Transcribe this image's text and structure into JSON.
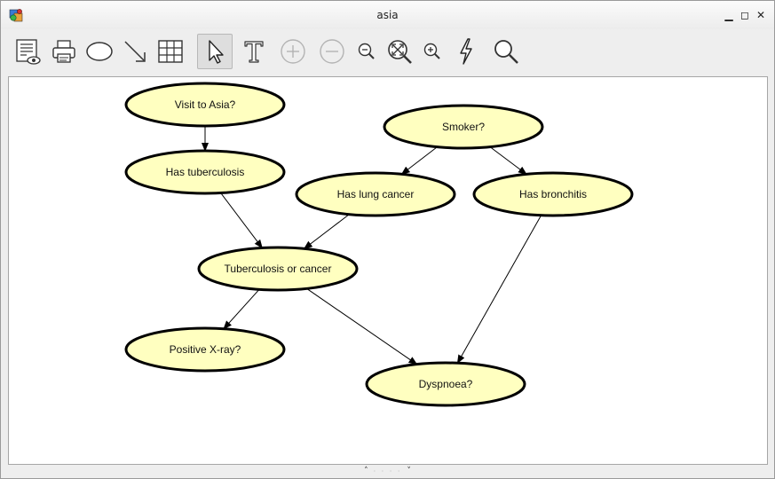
{
  "window": {
    "title": "asia",
    "controls": {
      "minimize": "▁",
      "maximize": "◻",
      "close": "✕"
    }
  },
  "toolbar": {
    "buttons": [
      {
        "name": "node-monitor-button",
        "icon": "monitor-eye-icon"
      },
      {
        "name": "print-button",
        "icon": "printer-icon"
      },
      {
        "name": "add-node-button",
        "icon": "ellipse-icon"
      },
      {
        "name": "add-arc-button",
        "icon": "arrow-icon"
      },
      {
        "name": "table-button",
        "icon": "table-icon"
      },
      {
        "name": "select-button",
        "icon": "pointer-icon",
        "active": true
      },
      {
        "name": "text-button",
        "icon": "text-icon"
      },
      {
        "name": "expand-button",
        "icon": "plus-circle-icon",
        "disabled": true
      },
      {
        "name": "collapse-button",
        "icon": "minus-circle-icon",
        "disabled": true
      },
      {
        "name": "zoom-out-button",
        "icon": "zoom-out-icon"
      },
      {
        "name": "zoom-fit-button",
        "icon": "zoom-fit-icon"
      },
      {
        "name": "zoom-in-button",
        "icon": "zoom-in-icon"
      },
      {
        "name": "propagate-button",
        "icon": "lightning-icon"
      },
      {
        "name": "search-button",
        "icon": "search-icon"
      }
    ]
  },
  "network": {
    "node_fill": "#ffffc0",
    "node_stroke": "#000000",
    "nodes": [
      {
        "id": "visit",
        "label": "Visit to Asia?"
      },
      {
        "id": "smoker",
        "label": "Smoker?"
      },
      {
        "id": "tuber",
        "label": "Has tuberculosis"
      },
      {
        "id": "lung",
        "label": "Has lung cancer"
      },
      {
        "id": "bronc",
        "label": "Has bronchitis"
      },
      {
        "id": "either",
        "label": "Tuberculosis or cancer"
      },
      {
        "id": "xray",
        "label": "Positive X-ray?"
      },
      {
        "id": "dysp",
        "label": "Dyspnoea?"
      }
    ],
    "edges": [
      {
        "from": "visit",
        "to": "tuber"
      },
      {
        "from": "smoker",
        "to": "lung"
      },
      {
        "from": "smoker",
        "to": "bronc"
      },
      {
        "from": "tuber",
        "to": "either"
      },
      {
        "from": "lung",
        "to": "either"
      },
      {
        "from": "either",
        "to": "xray"
      },
      {
        "from": "either",
        "to": "dysp"
      },
      {
        "from": "bronc",
        "to": "dysp"
      }
    ]
  },
  "splitter": {
    "up": "˄",
    "down": "˅"
  }
}
